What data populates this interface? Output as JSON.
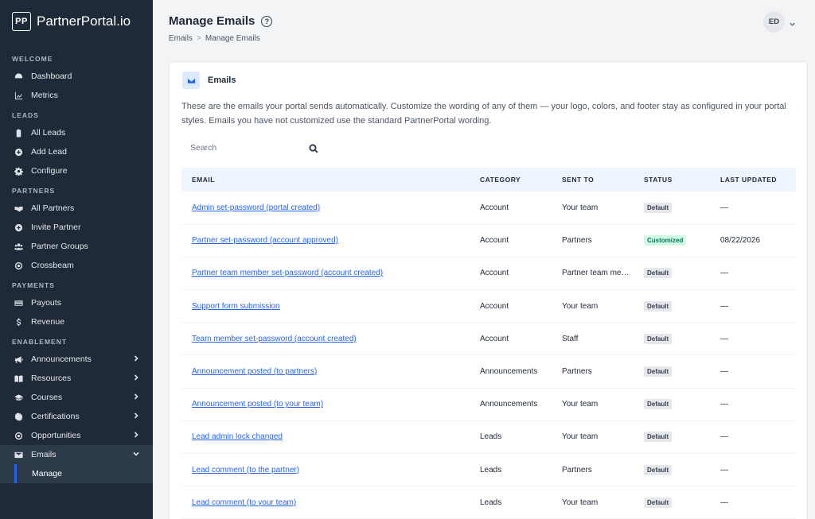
{
  "brand": {
    "logo": "PP",
    "name": "PartnerPortal.io"
  },
  "sidebar": {
    "sections": [
      {
        "label": "WELCOME",
        "items": [
          {
            "label": "Dashboard",
            "icon": "dashboard-icon"
          },
          {
            "label": "Metrics",
            "icon": "chart-line-icon"
          }
        ]
      },
      {
        "label": "LEADS",
        "items": [
          {
            "label": "All Leads",
            "icon": "clipboard-icon"
          },
          {
            "label": "Add Lead",
            "icon": "plus-circle-icon"
          },
          {
            "label": "Configure",
            "icon": "gear-icon"
          }
        ]
      },
      {
        "label": "PARTNERS",
        "items": [
          {
            "label": "All Partners",
            "icon": "handshake-icon"
          },
          {
            "label": "Invite Partner",
            "icon": "plus-circle-icon"
          },
          {
            "label": "Partner Groups",
            "icon": "users-icon"
          },
          {
            "label": "Crossbeam",
            "icon": "target-icon"
          }
        ]
      },
      {
        "label": "PAYMENTS",
        "items": [
          {
            "label": "Payouts",
            "icon": "credit-card-icon"
          },
          {
            "label": "Revenue",
            "icon": "dollar-icon"
          }
        ]
      },
      {
        "label": "ENABLEMENT",
        "items": [
          {
            "label": "Announcements",
            "icon": "megaphone-icon"
          },
          {
            "label": "Resources",
            "icon": "book-icon"
          },
          {
            "label": "Courses",
            "icon": "graduation-cap-icon"
          },
          {
            "label": "Certifications",
            "icon": "certificate-icon"
          },
          {
            "label": "Opportunities",
            "icon": "target-icon"
          },
          {
            "label": "Emails",
            "icon": "envelope-icon"
          }
        ]
      }
    ],
    "sub_item": "Manage"
  },
  "header": {
    "title": "Manage Emails",
    "help": "?",
    "breadcrumb": [
      "Emails",
      "Manage Emails"
    ],
    "breadcrumb_sep": ">",
    "avatar": "ED"
  },
  "card": {
    "title": "Emails",
    "description": "These are the emails your portal sends automatically. Customize the wording of any of them — your logo, colors, and footer stay as configured in your portal styles. Emails you have not customized use the standard PartnerPortal wording.",
    "search_placeholder": "Search",
    "columns": [
      "EMAIL",
      "CATEGORY",
      "SENT TO",
      "STATUS",
      "LAST UPDATED"
    ],
    "rows": [
      {
        "email": "Admin set-password (portal created)",
        "category": "Account",
        "sent_to": "Your team",
        "status": "Default",
        "updated": "—"
      },
      {
        "email": "Partner set-password (account approved)",
        "category": "Account",
        "sent_to": "Partners",
        "status": "Customized",
        "updated": "08/22/2026"
      },
      {
        "email": "Partner team member set-password (account created)",
        "category": "Account",
        "sent_to": "Partner team me…",
        "status": "Default",
        "updated": "—"
      },
      {
        "email": "Support form submission",
        "category": "Account",
        "sent_to": "Your team",
        "status": "Default",
        "updated": "—"
      },
      {
        "email": "Team member set-password (account created)",
        "category": "Account",
        "sent_to": "Staff",
        "status": "Default",
        "updated": "—"
      },
      {
        "email": "Announcement posted (to partners)",
        "category": "Announcements",
        "sent_to": "Partners",
        "status": "Default",
        "updated": "—"
      },
      {
        "email": "Announcement posted (to your team)",
        "category": "Announcements",
        "sent_to": "Your team",
        "status": "Default",
        "updated": "—"
      },
      {
        "email": "Lead admin lock changed",
        "category": "Leads",
        "sent_to": "Your team",
        "status": "Default",
        "updated": "—"
      },
      {
        "email": "Lead comment (to the partner)",
        "category": "Leads",
        "sent_to": "Partners",
        "status": "Default",
        "updated": "—"
      },
      {
        "email": "Lead comment (to your team)",
        "category": "Leads",
        "sent_to": "Your team",
        "status": "Default",
        "updated": "—"
      }
    ]
  }
}
